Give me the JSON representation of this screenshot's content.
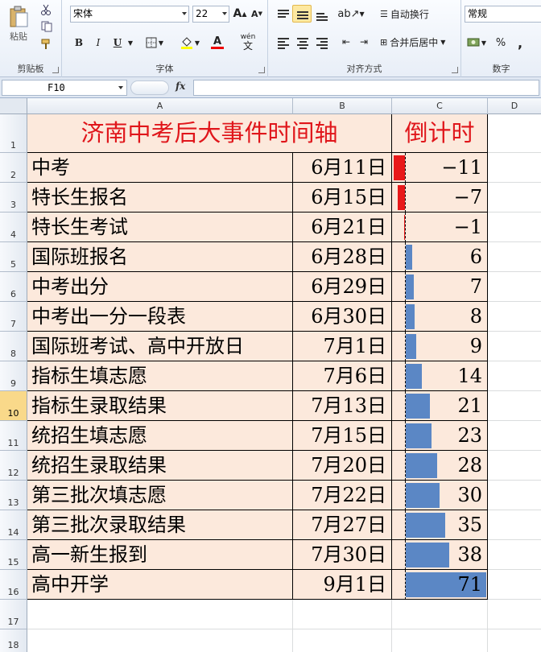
{
  "ribbon": {
    "clipboard": {
      "paste_label": "粘贴",
      "group_label": "剪贴板"
    },
    "font": {
      "name": "宋体",
      "size": "22",
      "bold": "B",
      "italic": "I",
      "underline": "U",
      "grow": "A",
      "shrink": "A",
      "font_color_glyph": "A",
      "wen": "wén",
      "group_label": "字体"
    },
    "alignment": {
      "wrap_label": "自动换行",
      "merge_label": "合并后居中",
      "group_label": "对齐方式"
    },
    "number": {
      "format": "常规",
      "percent": "%",
      "comma": ",",
      "group_label": "数字"
    }
  },
  "formula_bar": {
    "name_box": "F10",
    "fx_label": "fx",
    "content": ""
  },
  "columns": [
    "A",
    "B",
    "C",
    "D"
  ],
  "highlight_color": "#f9d98a",
  "table": {
    "title": "济南中考后大事件时间轴",
    "countdown_header": "倒计时",
    "rows": [
      {
        "row": "2",
        "event": "中考",
        "date": "6月11日",
        "days": -11
      },
      {
        "row": "3",
        "event": "特长生报名",
        "date": "6月15日",
        "days": -7
      },
      {
        "row": "4",
        "event": "特长生考试",
        "date": "6月21日",
        "days": -1
      },
      {
        "row": "5",
        "event": "国际班报名",
        "date": "6月28日",
        "days": 6
      },
      {
        "row": "6",
        "event": "中考出分",
        "date": "6月29日",
        "days": 7
      },
      {
        "row": "7",
        "event": "中考出一分一段表",
        "date": "6月30日",
        "days": 8
      },
      {
        "row": "8",
        "event": "国际班考试、高中开放日",
        "date": "7月1日",
        "days": 9
      },
      {
        "row": "9",
        "event": "指标生填志愿",
        "date": "7月6日",
        "days": 14
      },
      {
        "row": "10",
        "event": "指标生录取结果",
        "date": "7月13日",
        "days": 21
      },
      {
        "row": "11",
        "event": "统招生填志愿",
        "date": "7月15日",
        "days": 23
      },
      {
        "row": "12",
        "event": "统招生录取结果",
        "date": "7月20日",
        "days": 28
      },
      {
        "row": "13",
        "event": "第三批次填志愿",
        "date": "7月22日",
        "days": 30
      },
      {
        "row": "14",
        "event": "第三批次录取结果",
        "date": "7月27日",
        "days": 35
      },
      {
        "row": "15",
        "event": "高一新生报到",
        "date": "7月30日",
        "days": 38
      },
      {
        "row": "16",
        "event": "高中开学",
        "date": "9月1日",
        "days": 71
      }
    ],
    "positive_bar_color": "#5b87c5",
    "negative_bar_color": "#e8191a"
  },
  "row_numbers": [
    "1",
    "17",
    "18"
  ],
  "selected_row": "10"
}
